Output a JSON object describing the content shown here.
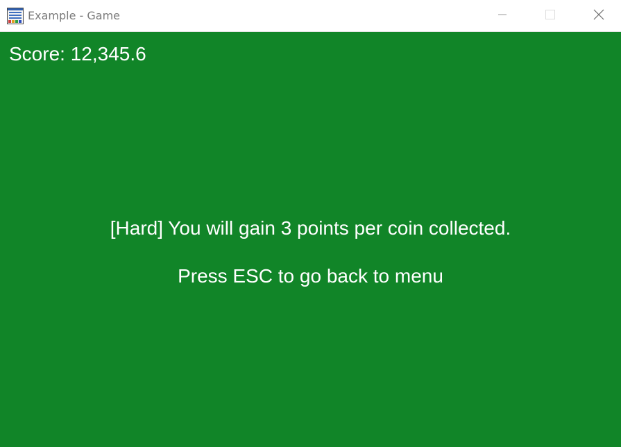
{
  "window": {
    "title": "Example - Game",
    "icon": "app-window-icon",
    "controls": [
      "minimize-icon",
      "maximize-icon",
      "close-icon"
    ]
  },
  "game": {
    "background_color": "#118528",
    "text_color": "#ffffff",
    "score_text": "Score: 12,345.6",
    "difficulty_message": "[Hard] You will gain 3 points per coin collected.",
    "escape_hint": "Press ESC to go back to menu"
  }
}
